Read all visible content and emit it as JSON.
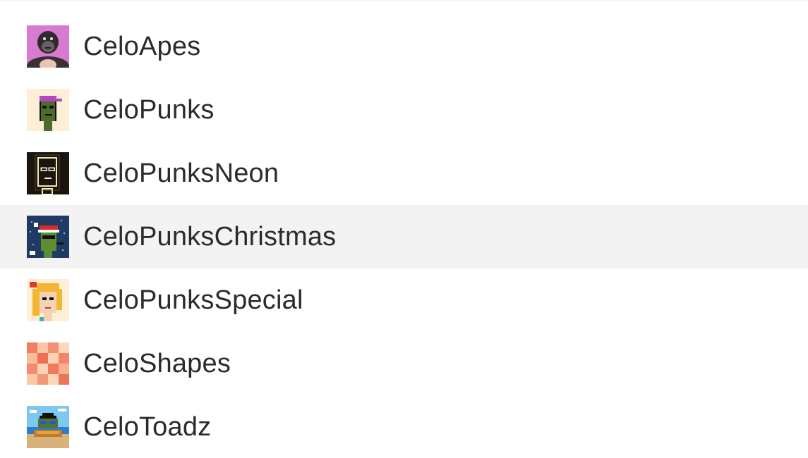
{
  "collections": {
    "highlighted_item": "CeloPunksChristmas",
    "items": [
      {
        "label": "CeloApes",
        "icon": "gorilla-avatar-icon"
      },
      {
        "label": "CeloPunks",
        "icon": "pixel-punk-avatar-icon"
      },
      {
        "label": "CeloPunksNeon",
        "icon": "neon-punk-avatar-icon"
      },
      {
        "label": "CeloPunksChristmas",
        "icon": "christmas-punk-avatar-icon"
      },
      {
        "label": "CeloPunksSpecial",
        "icon": "blonde-punk-avatar-icon"
      },
      {
        "label": "CeloShapes",
        "icon": "orange-shapes-avatar-icon"
      },
      {
        "label": "CeloToadz",
        "icon": "toad-avatar-icon"
      }
    ]
  },
  "colors": {
    "highlight_background": "#f3f3f3",
    "label_text": "#2b2b2b"
  }
}
